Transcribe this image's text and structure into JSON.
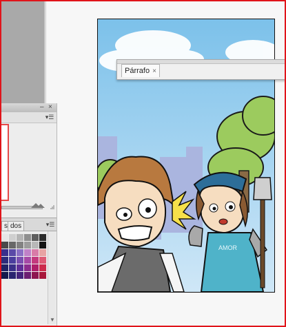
{
  "layers_panel": {
    "minimize_glyph": "‒",
    "close_glyph": "×",
    "menu_glyph": "▾☰"
  },
  "swatches_panel": {
    "tab_a": "s",
    "tab_b": "dos",
    "menu_glyph": "▾☰"
  },
  "paragraph_panel": {
    "tab_label": "Párrafo",
    "close_glyph": "×"
  },
  "swatch_colors": [
    "#e6e6e6",
    "#cfcfcf",
    "#b5b5b5",
    "#8f8f8f",
    "#5e5e5e",
    "#2b2b2b",
    "#4a4a4a",
    "#686868",
    "#828282",
    "#9c9c9c",
    "#b8b8b8",
    "#141414",
    "#3a2f8c",
    "#5a4aa8",
    "#8a6fc4",
    "#c081c8",
    "#d97ca8",
    "#e8a3a3",
    "#2d2c7a",
    "#4b3e9e",
    "#7a4fb0",
    "#a64aa6",
    "#c43a7e",
    "#de5a74",
    "#1f2364",
    "#3a2f88",
    "#5f2f98",
    "#8c2d8e",
    "#b01f6a",
    "#cc2a4a",
    "#151a4c",
    "#2a2470",
    "#44237c",
    "#6c1e72",
    "#8e1650",
    "#a8173a"
  ],
  "artwork": {
    "shirt_text": "AMOR"
  }
}
